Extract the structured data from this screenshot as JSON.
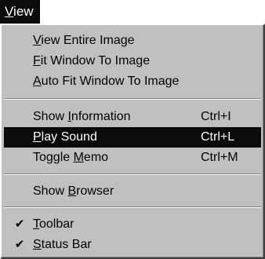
{
  "menubar": {
    "title_mnemonic": "V",
    "title_rest": "iew"
  },
  "menu": {
    "items": [
      {
        "pre": "",
        "mnemonic": "V",
        "post": "iew Entire Image",
        "shortcut": "",
        "checked": false,
        "selected": false
      },
      {
        "pre": "",
        "mnemonic": "F",
        "post": "it Window To Image",
        "shortcut": "",
        "checked": false,
        "selected": false
      },
      {
        "pre": "",
        "mnemonic": "A",
        "post": "uto Fit Window To Image",
        "shortcut": "",
        "checked": false,
        "selected": false
      },
      {
        "pre": "Show ",
        "mnemonic": "I",
        "post": "nformation",
        "shortcut": "Ctrl+I",
        "checked": false,
        "selected": false
      },
      {
        "pre": "",
        "mnemonic": "P",
        "post": "lay Sound",
        "shortcut": "Ctrl+L",
        "checked": false,
        "selected": true
      },
      {
        "pre": "Toggle ",
        "mnemonic": "M",
        "post": "emo",
        "shortcut": "Ctrl+M",
        "checked": false,
        "selected": false
      },
      {
        "pre": "Show ",
        "mnemonic": "B",
        "post": "rowser",
        "shortcut": "",
        "checked": false,
        "selected": false
      },
      {
        "pre": "",
        "mnemonic": "T",
        "post": "oolbar",
        "shortcut": "",
        "checked": true,
        "selected": false
      },
      {
        "pre": "",
        "mnemonic": "S",
        "post": "tatus Bar",
        "shortcut": "",
        "checked": true,
        "selected": false
      }
    ],
    "check_glyph": "✔"
  },
  "colors": {
    "menu_bg": "#c0c0c0",
    "highlight_bg": "#0b0b0b",
    "highlight_fg": "#ffffff"
  }
}
